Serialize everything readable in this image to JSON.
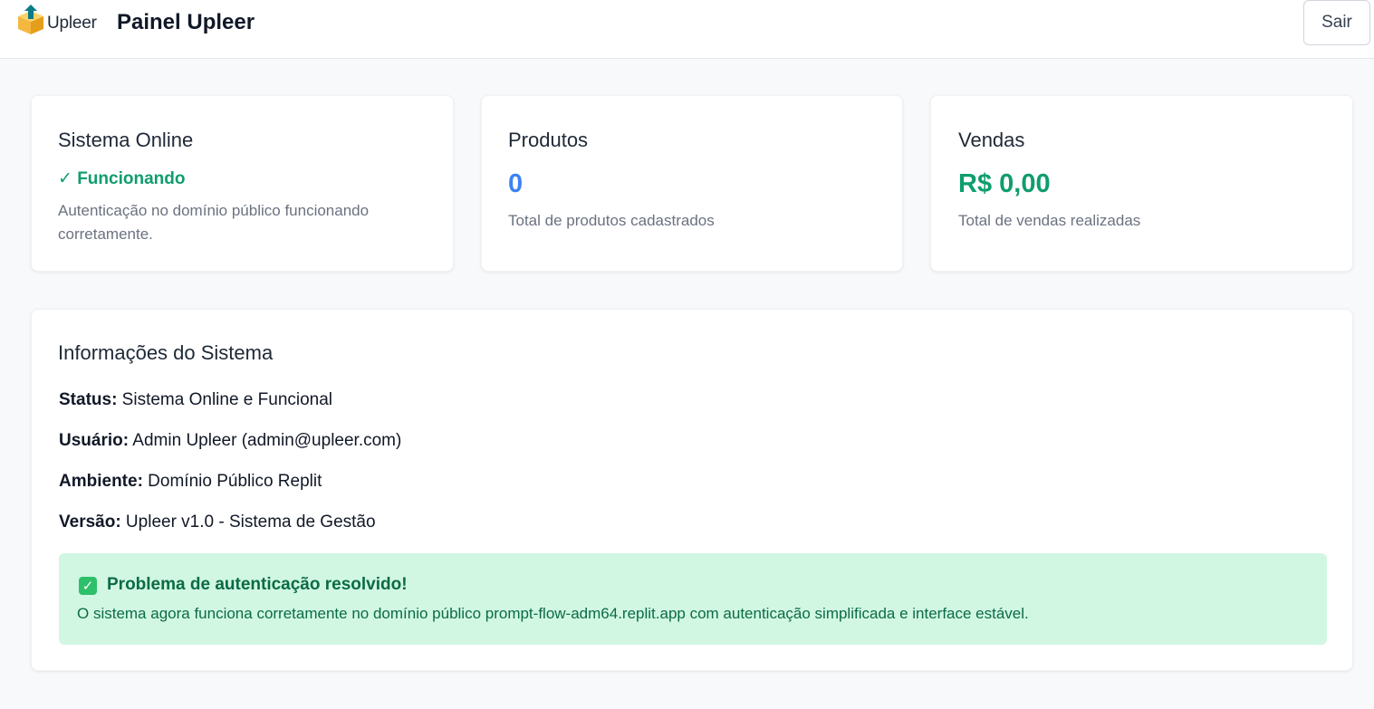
{
  "header": {
    "logo_text": "Upleer",
    "title": "Painel Upleer",
    "logout_label": "Sair"
  },
  "cards": {
    "system": {
      "title": "Sistema Online",
      "status": "✓ Funcionando",
      "description": "Autenticação no domínio público funcionando corretamente."
    },
    "products": {
      "title": "Produtos",
      "value": "0",
      "description": "Total de produtos cadastrados"
    },
    "sales": {
      "title": "Vendas",
      "value": "R$ 0,00",
      "description": "Total de vendas realizadas"
    }
  },
  "info": {
    "title": "Informações do Sistema",
    "rows": [
      {
        "label": "Status:",
        "value": " Sistema Online e Funcional"
      },
      {
        "label": "Usuário:",
        "value": " Admin Upleer (admin@upleer.com)"
      },
      {
        "label": "Ambiente:",
        "value": " Domínio Público Replit"
      },
      {
        "label": "Versão:",
        "value": " Upleer v1.0 - Sistema de Gestão"
      }
    ],
    "alert": {
      "icon": "✓",
      "title": "Problema de autenticação resolvido!",
      "text": "O sistema agora funciona corretamente no domínio público prompt-flow-adm64.replit.app com autenticação simplificada e interface estável."
    }
  },
  "colors": {
    "accent_green": "#0f9d6e",
    "accent_blue": "#3b82f6",
    "alert_bg": "#d1f7e3",
    "logo_orange": "#f4b740",
    "logo_teal": "#0e7c86"
  },
  "icons": {
    "logo": "box-upload-icon",
    "alert": "check-square-icon"
  }
}
